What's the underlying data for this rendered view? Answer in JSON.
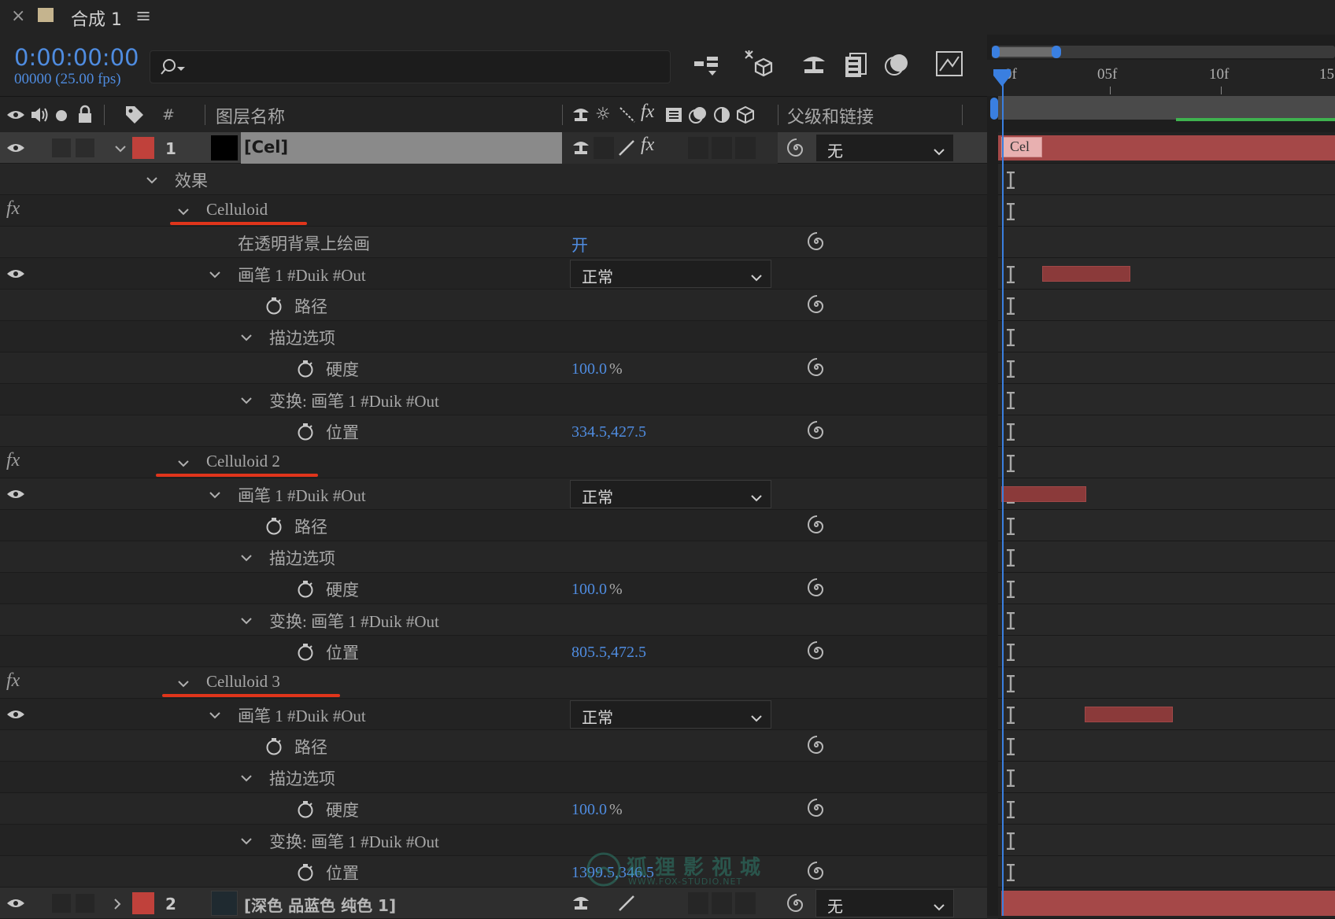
{
  "tab": {
    "close": "×",
    "title": "合成 1",
    "menu": "≡"
  },
  "time": {
    "timecode": "0:00:00:00",
    "frames": "00000 (25.00 fps)"
  },
  "search": {
    "placeholder": ""
  },
  "toolbar_icons": [
    "composition-flowchart-icon",
    "draft-3d-icon",
    "shy-layers-icon",
    "frame-blending-icon",
    "motion-blur-icon",
    "graph-editor-icon"
  ],
  "ruler": {
    "ticks": [
      "0f",
      "05f",
      "10f",
      "15"
    ]
  },
  "header": {
    "hash": "#",
    "layer_name": "图层名称",
    "parent": "父级和链接"
  },
  "layers": [
    {
      "num": "1",
      "name": "[Cel]",
      "parent": "无",
      "bar_label": "Cel",
      "color": "#c0413b"
    },
    {
      "num": "2",
      "name": "[深色 品蓝色 纯色 1]",
      "parent": "无",
      "color": "#c0413b"
    }
  ],
  "effects_label": "效果",
  "effects": [
    {
      "name": "Celluloid",
      "paint_on_transparent": "在透明背景上绘画",
      "paint_on_transparent_value": "开",
      "brush": "画笔 1 #Duik #Out",
      "blend": "正常",
      "path": "路径",
      "stroke_options": "描边选项",
      "hardness": "硬度",
      "hardness_value": "100.0",
      "hardness_unit": "%",
      "transform": "变换: 画笔 1 #Duik #Out",
      "position": "位置",
      "position_value": "334.5,427.5"
    },
    {
      "name": "Celluloid 2",
      "brush": "画笔 1 #Duik #Out",
      "blend": "正常",
      "path": "路径",
      "stroke_options": "描边选项",
      "hardness": "硬度",
      "hardness_value": "100.0",
      "hardness_unit": "%",
      "transform": "变换: 画笔 1 #Duik #Out",
      "position": "位置",
      "position_value": "805.5,472.5"
    },
    {
      "name": "Celluloid 3",
      "brush": "画笔 1 #Duik #Out",
      "blend": "正常",
      "path": "路径",
      "stroke_options": "描边选项",
      "hardness": "硬度",
      "hardness_value": "100.0",
      "hardness_unit": "%",
      "transform": "变换: 画笔 1 #Duik #Out",
      "position": "位置",
      "position_value": "1399.5,346.5"
    }
  ],
  "watermark": {
    "title": "狐狸影视城",
    "url": "WWW.FOX-STUDIO.NET"
  },
  "colors": {
    "accent_blue": "#4f8ce0",
    "label_red": "#c0413b",
    "underline_red": "#e0351b",
    "work_area_green": "#3fb34f"
  }
}
